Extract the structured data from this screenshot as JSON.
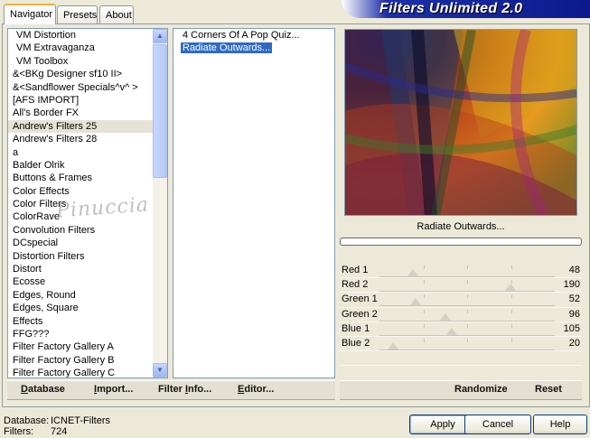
{
  "tabs": [
    {
      "label": "Navigator",
      "active": true
    },
    {
      "label": "Presets",
      "active": false
    },
    {
      "label": "About",
      "active": false
    }
  ],
  "app_title": "Filters Unlimited 2.0",
  "categories": [
    "VM Distortion",
    "VM Extravaganza",
    "VM Toolbox",
    "&<BKg Designer sf10 II>",
    "&<Sandflower Specials^v^ >",
    "[AFS IMPORT]",
    "All's Border FX",
    "Andrew's Filters 25",
    "Andrew's Filters 28",
    "a",
    "Balder Olrik",
    "Buttons & Frames",
    "Color Effects",
    "Color Filters",
    "ColorRave",
    "Convolution Filters",
    "DCspecial",
    "Distortion Filters",
    "Distort",
    "Ecosse",
    "Edges, Round",
    "Edges, Square",
    "Effects",
    "FFG???",
    "Filter Factory Gallery A",
    "Filter Factory Gallery B",
    "Filter Factory Gallery C"
  ],
  "selected_category": "Andrew's Filters 25",
  "filters": [
    "4 Corners Of A Pop Quiz...",
    "Radiate Outwards..."
  ],
  "selected_filter": "Radiate Outwards...",
  "preview_label": "Radiate Outwards...",
  "sliders": [
    {
      "label": "Red 1",
      "value": "48",
      "fraction": 0.19
    },
    {
      "label": "Red 2",
      "value": "190",
      "fraction": 0.745
    },
    {
      "label": "Green 1",
      "value": "52",
      "fraction": 0.204
    },
    {
      "label": "Green 2",
      "value": "96",
      "fraction": 0.376
    },
    {
      "label": "Blue 1",
      "value": "105",
      "fraction": 0.412
    },
    {
      "label": "Blue 2",
      "value": "20",
      "fraction": 0.078
    }
  ],
  "left_buttons": {
    "database": {
      "u": "D",
      "rest": "atabase"
    },
    "import": {
      "u": "I",
      "rest": "mport..."
    },
    "filter_info": {
      "pre": "Filter ",
      "u": "I",
      "rest": "nfo..."
    },
    "editor": {
      "u": "E",
      "rest": "ditor..."
    }
  },
  "right_buttons": {
    "randomize": "Randomize",
    "reset": "Reset"
  },
  "status": {
    "database_label": "Database:",
    "database_value": "ICNET-Filters",
    "filters_label": "Filters:",
    "filters_value": "724"
  },
  "dialog_buttons": {
    "apply": "Apply",
    "cancel": "Cancel",
    "help": "Help"
  },
  "watermark": "Pinuccia",
  "colors": {
    "selection": "#316ac5",
    "banner": "#0c1a8c"
  }
}
